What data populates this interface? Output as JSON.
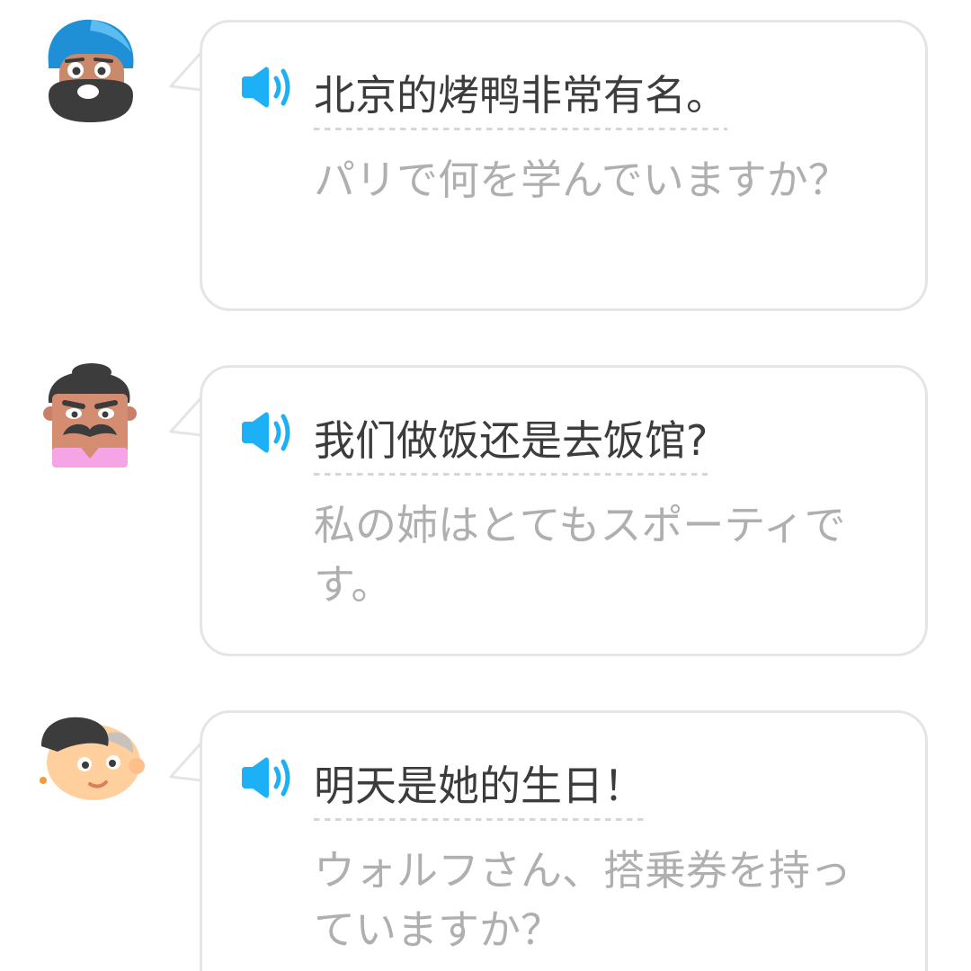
{
  "conversations": [
    {
      "avatar": "turban-man-avatar",
      "speaker_icon": "speaker-icon",
      "sentence": "北京的烤鸭非常有名。",
      "translation": "パリで何を学んでいますか？"
    },
    {
      "avatar": "mustache-man-avatar",
      "speaker_icon": "speaker-icon",
      "sentence": "我们做饭还是去饭馆?",
      "translation": "私の姉はとてもスポーティです。"
    },
    {
      "avatar": "bald-man-avatar",
      "speaker_icon": "speaker-icon",
      "sentence": "明天是她的生日！",
      "translation": "ウォルフさん、搭乗券を持っていますか？"
    }
  ],
  "colors": {
    "speaker_blue": "#1cb0f6",
    "bubble_border": "#e5e5e5",
    "sentence_text": "#3c3c3c",
    "translation_text": "#afafaf"
  }
}
